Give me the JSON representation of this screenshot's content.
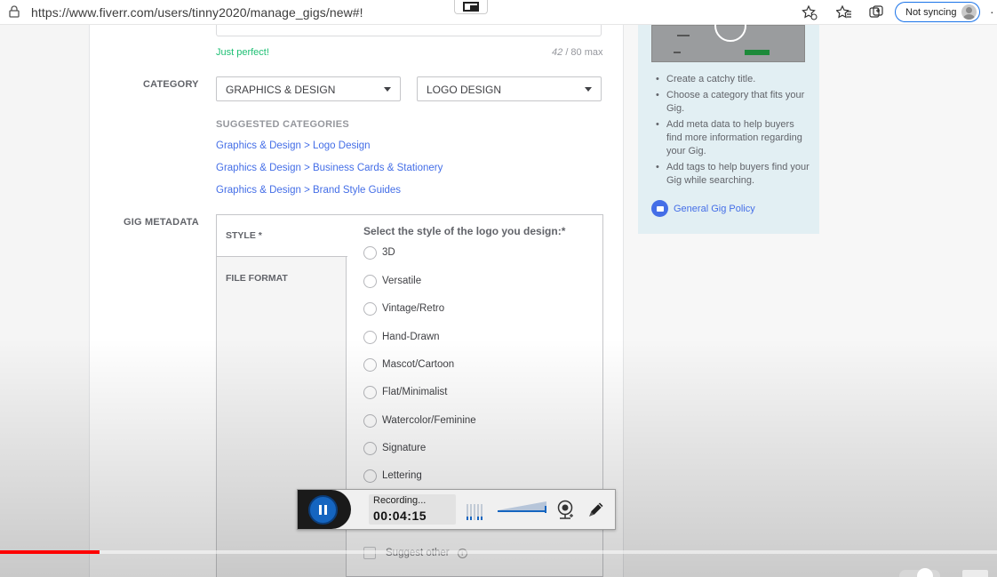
{
  "browser": {
    "url": "https://www.fiverr.com/users/tinny2020/manage_gigs/new#!",
    "sync_label": "Not syncing"
  },
  "title_field": {
    "feedback": "Just perfect!",
    "char_count": "42",
    "char_max": "/ 80 max"
  },
  "category": {
    "label": "CATEGORY",
    "primary": "GRAPHICS & DESIGN",
    "secondary": "LOGO DESIGN",
    "suggested_title": "SUGGESTED CATEGORIES",
    "suggested": [
      "Graphics & Design > Logo Design",
      "Graphics & Design > Business Cards & Stationery",
      "Graphics & Design > Brand Style Guides"
    ]
  },
  "metadata": {
    "label": "GIG METADATA",
    "tabs": [
      "STYLE *",
      "FILE FORMAT"
    ],
    "question": "Select the style of the logo you design:*",
    "options": [
      "3D",
      "Versatile",
      "Vintage/Retro",
      "Hand-Drawn",
      "Mascot/Cartoon",
      "Flat/Minimalist",
      "Watercolor/Feminine",
      "Signature",
      "Lettering"
    ],
    "suggest_other": "Suggest other"
  },
  "tips": {
    "items": [
      "Create a catchy title.",
      "Choose a category that fits your Gig.",
      "Add meta data to help buyers find more information regarding your Gig.",
      "Add tags to help buyers find your Gig while searching."
    ],
    "policy_link": "General Gig Policy"
  },
  "recorder": {
    "status": "Recording...",
    "time": "00:04:15"
  },
  "video": {
    "progress_fraction": 0.1
  },
  "colors": {
    "link": "#446ee7",
    "success": "#1dbf73",
    "recorder_accent": "#1565c0",
    "progress": "#ff0000"
  }
}
